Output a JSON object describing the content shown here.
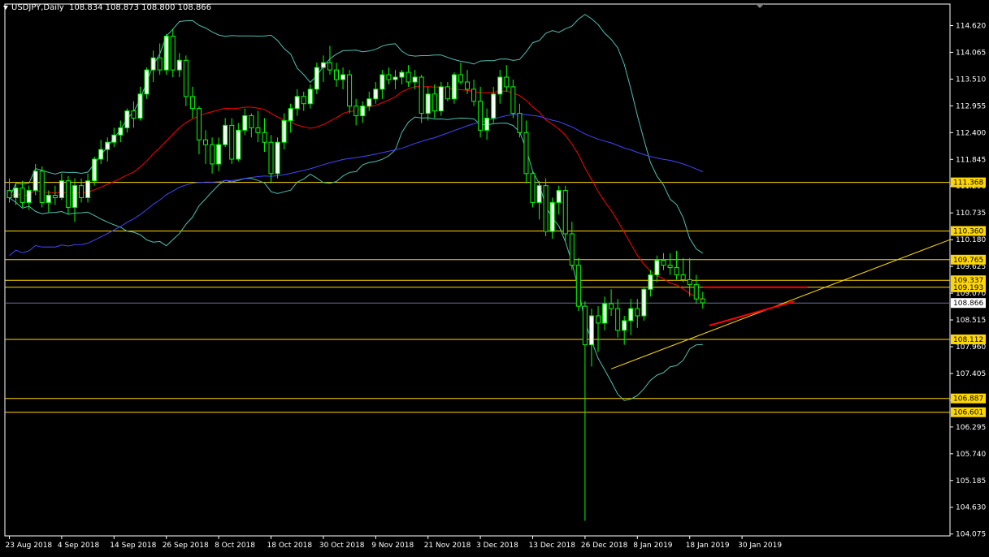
{
  "header": {
    "symbol": "USDJPY,Daily",
    "ohlc": "108.834 108.873 108.800 108.866"
  },
  "colors": {
    "background": "#000000",
    "axis": "#ffffff",
    "candle_bull": "#ffffff",
    "candle_bear": "#000000",
    "wick": "#00ff00",
    "hline": "#ffd700",
    "bollinger": "#4fc0b0",
    "ma_mid": "#ff0000",
    "ma_long": "#4444ff",
    "trendline": "#ffd700",
    "red_trend": "#ff0000",
    "price_tag_bg": "#ffd700",
    "current_tag_bg": "#ffffff"
  },
  "chart_data": {
    "type": "candlestick",
    "symbol": "USDJPY",
    "timeframe": "Daily",
    "ylim": [
      104.07,
      114.62
    ],
    "y_ticks": [
      114.62,
      114.065,
      113.51,
      112.955,
      112.4,
      111.845,
      111.29,
      110.735,
      110.18,
      109.625,
      109.07,
      108.515,
      107.96,
      107.405,
      106.85,
      106.295,
      105.74,
      105.185,
      104.63,
      104.075
    ],
    "x_labels": [
      "23 Aug 2018",
      "4 Sep 2018",
      "14 Sep 2018",
      "26 Sep 2018",
      "8 Oct 2018",
      "18 Oct 2018",
      "30 Oct 2018",
      "9 Nov 2018",
      "21 Nov 2018",
      "3 Dec 2018",
      "13 Dec 2018",
      "26 Dec 2018",
      "8 Jan 2019",
      "18 Jan 2019",
      "30 Jan 2019"
    ],
    "x_label_bars": [
      0,
      8,
      16,
      24,
      32,
      40,
      48,
      56,
      64,
      72,
      80,
      88,
      96,
      104,
      112
    ],
    "horizontal_levels": [
      111.368,
      110.36,
      109.765,
      109.337,
      109.193,
      108.112,
      106.887,
      106.601
    ],
    "current_price": 108.866,
    "candles": [
      [
        111.2,
        111.45,
        110.95,
        111.05
      ],
      [
        111.05,
        111.35,
        110.9,
        111.25
      ],
      [
        111.25,
        111.4,
        110.85,
        110.95
      ],
      [
        110.95,
        111.3,
        110.8,
        111.2
      ],
      [
        111.2,
        111.75,
        111.1,
        111.6
      ],
      [
        111.6,
        111.7,
        110.85,
        110.95
      ],
      [
        110.95,
        111.2,
        110.75,
        111.1
      ],
      [
        111.1,
        111.3,
        110.9,
        111.05
      ],
      [
        111.05,
        111.55,
        111.0,
        111.4
      ],
      [
        111.4,
        111.5,
        110.7,
        110.85
      ],
      [
        110.85,
        111.45,
        110.55,
        111.3
      ],
      [
        111.3,
        111.45,
        110.95,
        111.05
      ],
      [
        111.05,
        111.55,
        110.95,
        111.4
      ],
      [
        111.4,
        111.9,
        111.3,
        111.85
      ],
      [
        111.85,
        112.25,
        111.75,
        112.05
      ],
      [
        112.05,
        112.3,
        111.8,
        112.2
      ],
      [
        112.2,
        112.5,
        112.1,
        112.35
      ],
      [
        112.35,
        112.65,
        112.2,
        112.5
      ],
      [
        112.5,
        112.9,
        112.4,
        112.85
      ],
      [
        112.85,
        113.05,
        112.5,
        112.7
      ],
      [
        112.7,
        113.35,
        112.65,
        113.2
      ],
      [
        113.2,
        113.75,
        113.1,
        113.7
      ],
      [
        113.7,
        114.1,
        113.45,
        113.95
      ],
      [
        113.95,
        114.25,
        113.6,
        113.7
      ],
      [
        113.7,
        114.45,
        113.6,
        114.4
      ],
      [
        114.4,
        114.55,
        113.55,
        113.7
      ],
      [
        113.7,
        114.05,
        113.55,
        113.9
      ],
      [
        113.9,
        114.0,
        112.95,
        113.15
      ],
      [
        113.15,
        113.35,
        112.7,
        112.9
      ],
      [
        112.9,
        112.95,
        111.95,
        112.25
      ],
      [
        112.25,
        112.45,
        111.75,
        112.15
      ],
      [
        112.15,
        112.3,
        111.55,
        111.75
      ],
      [
        111.75,
        112.3,
        111.6,
        112.15
      ],
      [
        112.15,
        112.7,
        112.1,
        112.55
      ],
      [
        112.55,
        112.7,
        111.75,
        111.85
      ],
      [
        111.85,
        112.6,
        111.8,
        112.45
      ],
      [
        112.45,
        112.9,
        112.35,
        112.75
      ],
      [
        112.75,
        112.8,
        112.3,
        112.5
      ],
      [
        112.5,
        112.85,
        112.2,
        112.4
      ],
      [
        112.4,
        112.7,
        112.0,
        112.2
      ],
      [
        112.2,
        112.35,
        111.35,
        111.55
      ],
      [
        111.55,
        112.3,
        111.45,
        112.2
      ],
      [
        112.2,
        112.8,
        112.05,
        112.65
      ],
      [
        112.65,
        113.0,
        112.4,
        112.9
      ],
      [
        112.9,
        113.3,
        112.75,
        113.15
      ],
      [
        113.15,
        113.25,
        112.85,
        113.0
      ],
      [
        113.0,
        113.4,
        112.9,
        113.3
      ],
      [
        113.3,
        113.85,
        113.2,
        113.75
      ],
      [
        113.75,
        114.0,
        113.45,
        113.85
      ],
      [
        113.85,
        114.2,
        113.6,
        113.7
      ],
      [
        113.7,
        113.85,
        113.35,
        113.5
      ],
      [
        113.5,
        113.75,
        113.3,
        113.6
      ],
      [
        113.6,
        113.7,
        112.8,
        112.95
      ],
      [
        112.95,
        113.1,
        112.55,
        112.75
      ],
      [
        112.75,
        113.05,
        112.6,
        112.95
      ],
      [
        112.95,
        113.25,
        112.85,
        113.1
      ],
      [
        113.1,
        113.45,
        113.0,
        113.3
      ],
      [
        113.3,
        113.7,
        113.1,
        113.6
      ],
      [
        113.6,
        113.75,
        113.4,
        113.5
      ],
      [
        113.5,
        113.7,
        113.3,
        113.55
      ],
      [
        113.55,
        113.7,
        113.4,
        113.65
      ],
      [
        113.65,
        113.8,
        113.35,
        113.45
      ],
      [
        113.45,
        113.7,
        113.3,
        113.55
      ],
      [
        113.55,
        113.6,
        112.6,
        112.8
      ],
      [
        112.8,
        113.35,
        112.65,
        113.2
      ],
      [
        113.2,
        113.4,
        112.7,
        112.85
      ],
      [
        112.85,
        113.45,
        112.75,
        113.35
      ],
      [
        113.35,
        113.45,
        113.05,
        113.1
      ],
      [
        113.1,
        113.65,
        113.0,
        113.6
      ],
      [
        113.6,
        113.85,
        113.4,
        113.45
      ],
      [
        113.45,
        113.7,
        113.2,
        113.3
      ],
      [
        113.3,
        113.5,
        112.95,
        113.05
      ],
      [
        113.05,
        113.35,
        112.3,
        112.45
      ],
      [
        112.45,
        112.9,
        112.25,
        112.7
      ],
      [
        112.7,
        113.35,
        112.6,
        113.2
      ],
      [
        113.2,
        113.7,
        113.0,
        113.55
      ],
      [
        113.55,
        113.8,
        113.25,
        113.35
      ],
      [
        113.35,
        113.5,
        112.7,
        112.8
      ],
      [
        112.8,
        113.0,
        112.3,
        112.4
      ],
      [
        112.4,
        112.65,
        111.35,
        111.55
      ],
      [
        111.55,
        111.6,
        110.85,
        110.95
      ],
      [
        110.95,
        111.4,
        110.6,
        111.3
      ],
      [
        111.3,
        111.45,
        110.25,
        110.35
      ],
      [
        110.35,
        111.05,
        110.2,
        110.95
      ],
      [
        110.95,
        111.3,
        110.7,
        111.2
      ],
      [
        111.2,
        111.3,
        110.15,
        110.3
      ],
      [
        110.3,
        110.55,
        109.55,
        109.65
      ],
      [
        109.65,
        109.8,
        108.7,
        108.8
      ],
      [
        108.8,
        108.9,
        104.35,
        108.0
      ],
      [
        108.0,
        108.75,
        107.55,
        108.6
      ],
      [
        108.6,
        108.8,
        107.85,
        108.45
      ],
      [
        108.45,
        109.0,
        108.3,
        108.85
      ],
      [
        108.85,
        109.15,
        108.6,
        108.75
      ],
      [
        108.75,
        108.95,
        108.15,
        108.3
      ],
      [
        108.3,
        108.6,
        108.0,
        108.5
      ],
      [
        108.5,
        108.95,
        108.2,
        108.75
      ],
      [
        108.75,
        108.95,
        108.35,
        108.6
      ],
      [
        108.6,
        109.2,
        108.5,
        109.15
      ],
      [
        109.15,
        109.55,
        109.0,
        109.45
      ],
      [
        109.45,
        109.85,
        109.3,
        109.75
      ],
      [
        109.75,
        109.9,
        109.55,
        109.65
      ],
      [
        109.65,
        109.9,
        109.45,
        109.6
      ],
      [
        109.6,
        109.95,
        109.35,
        109.45
      ],
      [
        109.45,
        109.8,
        109.3,
        109.35
      ],
      [
        109.35,
        109.8,
        109.0,
        109.25
      ],
      [
        109.25,
        109.45,
        108.85,
        108.95
      ],
      [
        108.95,
        109.1,
        108.75,
        108.87
      ]
    ]
  }
}
